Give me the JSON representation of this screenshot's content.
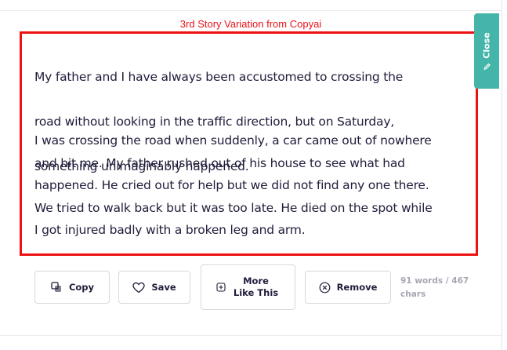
{
  "annotation": "3rd Story Variation from Copyai",
  "story": {
    "paragraph1": [
      " My father and I have always been accustomed to crossing the",
      "road without looking in the traffic direction, but on Saturday,",
      "something unimaginably happened."
    ],
    "paragraph2": [
      "I was crossing the road when suddenly, a car came out of nowhere",
      "and hit me. My father rushed out of his house to see what had",
      "happened. He cried out for help but we did not find any one there.",
      "We tried to walk back but it was too late. He died on the spot while",
      "I got injured badly with a broken leg and arm."
    ]
  },
  "actions": {
    "copy": "Copy",
    "save": "Save",
    "more_like_this": "More Like This",
    "remove": "Remove"
  },
  "stats": {
    "counts": "91 words / 467 chars"
  },
  "close_tab": {
    "label": "Close"
  },
  "colors": {
    "annotation_red": "#e8131b",
    "close_tab_teal": "#45b5aa",
    "text_dark": "#1f1d3a",
    "muted_gray": "#a6a6b3"
  }
}
